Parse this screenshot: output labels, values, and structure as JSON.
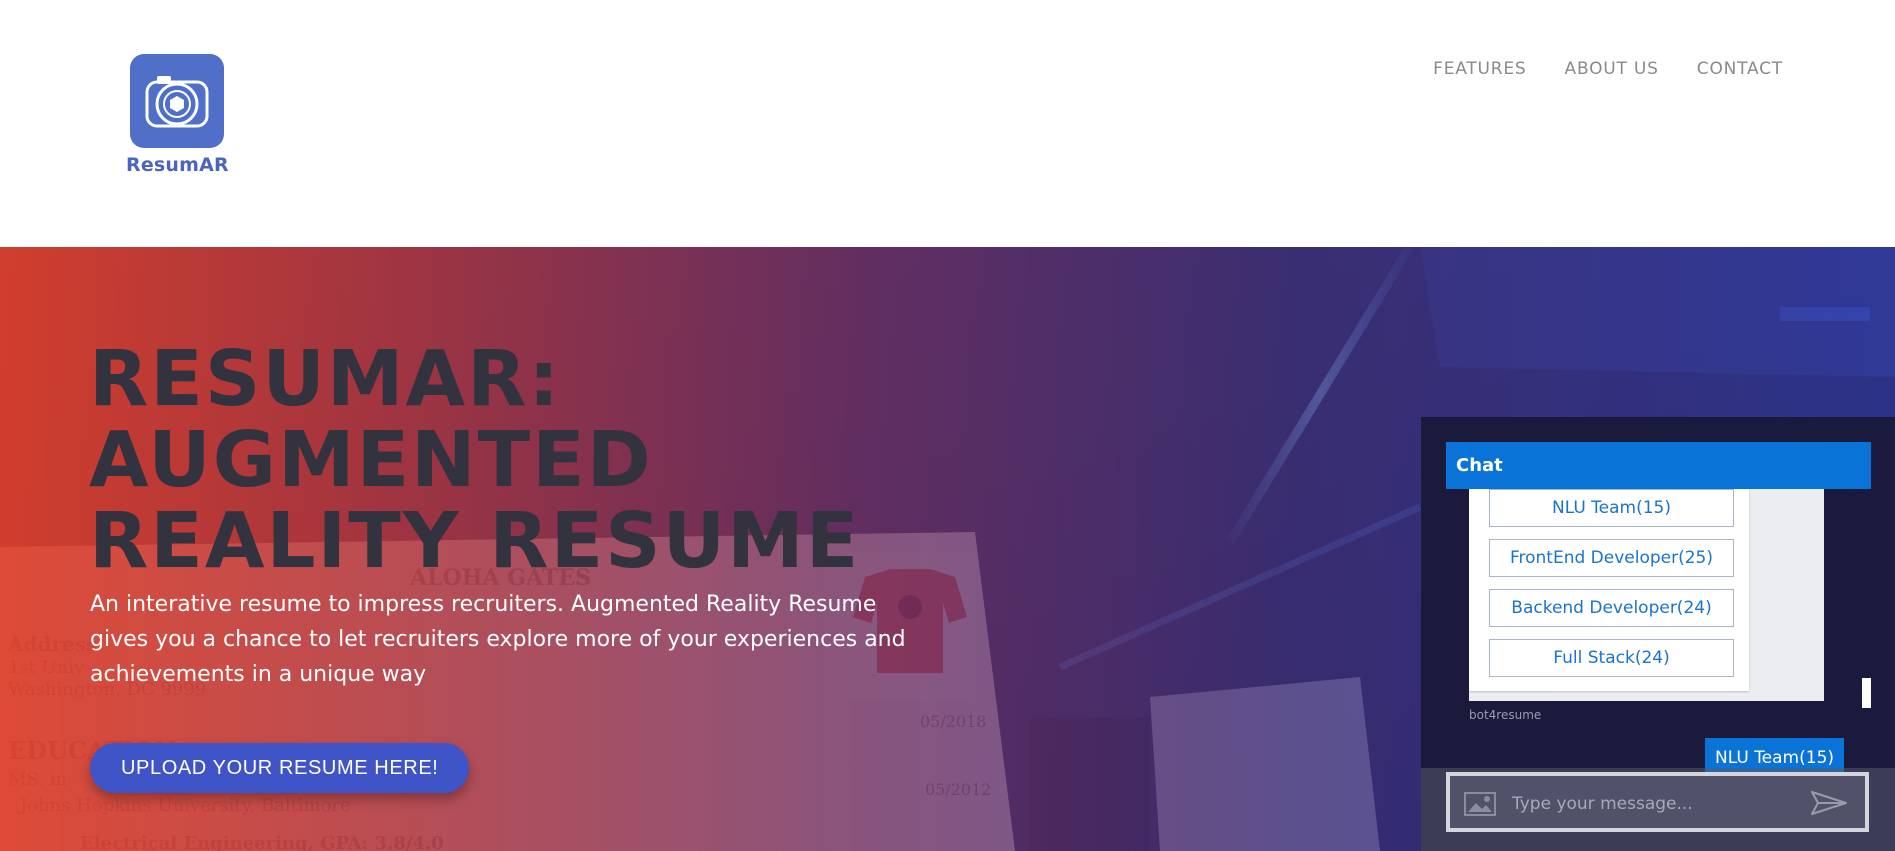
{
  "brand": {
    "name": "ResumAR",
    "logo_icon": "camera-aperture-icon",
    "color": "#4f6fc9"
  },
  "nav": {
    "items": [
      "FEATURES",
      "ABOUT US",
      "CONTACT"
    ]
  },
  "hero": {
    "title": "RESUMAR:\nAUGMENTED\nREALITY RESUME",
    "description": "An interative resume to impress recruiters. Augmented Reality Resume gives you a chance to let recruiters explore more of your experiences and achievements in a unique way",
    "cta_label": "UPLOAD YOUR RESUME HERE!"
  },
  "chat": {
    "title": "Chat",
    "suggestions": [
      "NLU Team(15)",
      "FrontEnd Developer(25)",
      "Backend Developer(24)",
      "Full Stack(24)"
    ],
    "bot_name": "bot4resume",
    "user_message": "NLU Team(15)",
    "input_placeholder": "Type your message...",
    "accent_color": "#0a73d8",
    "icons": {
      "attach": "image-icon",
      "send": "send-icon"
    }
  }
}
